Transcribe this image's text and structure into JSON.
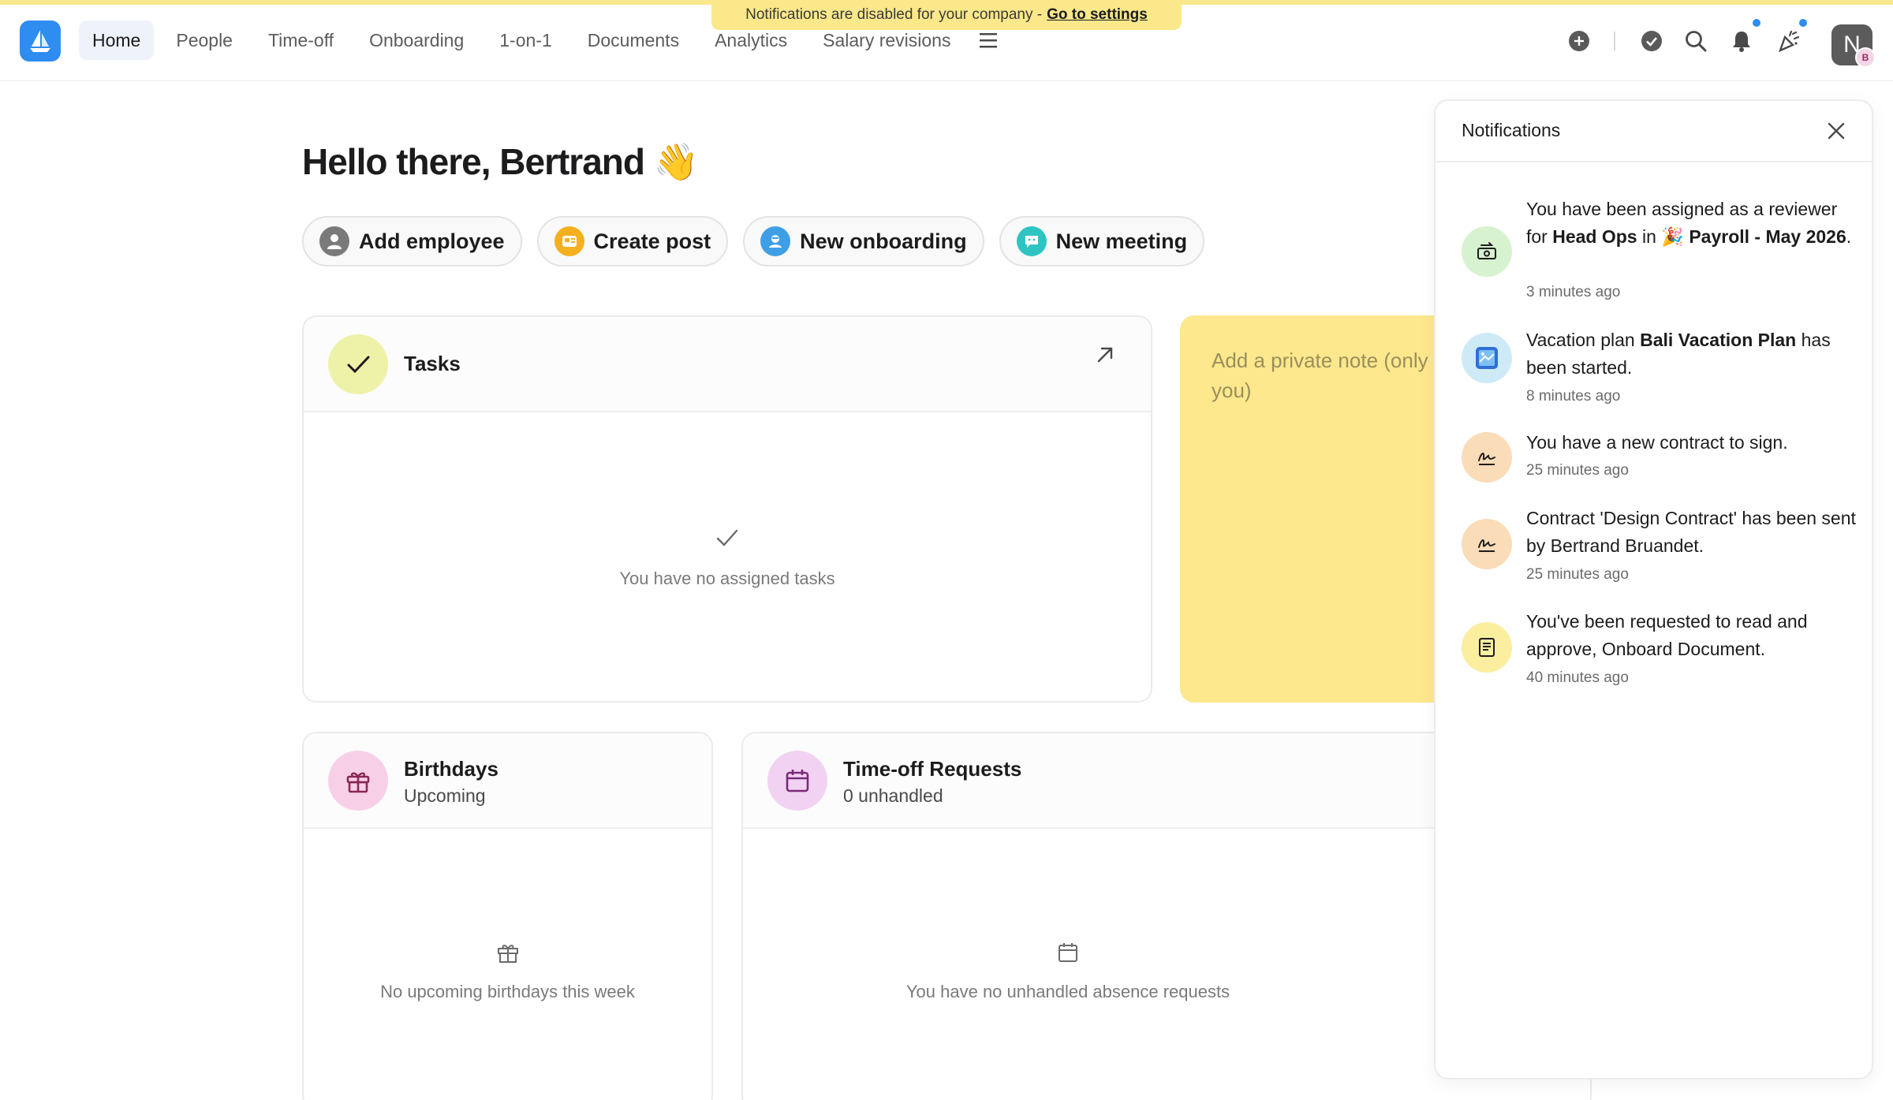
{
  "banner": {
    "text": "Notifications are disabled for your company -",
    "link": "Go to settings"
  },
  "nav": {
    "items": [
      {
        "label": "Home",
        "active": true
      },
      {
        "label": "People"
      },
      {
        "label": "Time-off"
      },
      {
        "label": "Onboarding"
      },
      {
        "label": "1-on-1"
      },
      {
        "label": "Documents"
      },
      {
        "label": "Analytics"
      },
      {
        "label": "Salary revisions"
      }
    ]
  },
  "header_icons": [
    "plus-circle-icon",
    "check-circle-icon",
    "search-icon",
    "bell-icon",
    "party-popper-icon"
  ],
  "user": {
    "avatar_initial": "N",
    "badge_initial": "B"
  },
  "greeting": "Hello there, Bertrand 👋",
  "actions": [
    {
      "label": "Add employee",
      "color": "#7a7a7a"
    },
    {
      "label": "Create post",
      "color": "#f5b01f"
    },
    {
      "label": "New onboarding",
      "color": "#3e9ee6"
    },
    {
      "label": "New meeting",
      "color": "#2ec4c4"
    }
  ],
  "tasks": {
    "title": "Tasks",
    "empty": "You have no assigned tasks"
  },
  "note": {
    "placeholder": "Add a private note (only you)"
  },
  "birthdays": {
    "title": "Birthdays",
    "subtitle": "Upcoming",
    "empty": "No upcoming birthdays this week"
  },
  "timeoff": {
    "title": "Time-off Requests",
    "subtitle": "0 unhandled",
    "empty": "You have no unhandled absence requests"
  },
  "notifications": {
    "title": "Notifications",
    "items": [
      {
        "parts": [
          "You have been assigned as a reviewer for ",
          "Head Ops",
          " in 🎉 ",
          "Payroll - May 2026",
          "."
        ],
        "time": "3 minutes ago",
        "icon": "money-transfer-icon",
        "color": "#d7f2cf"
      },
      {
        "parts": [
          "Vacation plan ",
          "Bali Vacation Plan",
          " has been started."
        ],
        "time": "8 minutes ago",
        "icon": "vacation-icon",
        "color": "#cfeaf7"
      },
      {
        "parts": [
          "You have a new contract to sign."
        ],
        "time": "25 minutes ago",
        "icon": "signature-icon",
        "color": "#fbdcb8"
      },
      {
        "parts": [
          "Contract 'Design Contract' has been sent by Bertrand Bruandet."
        ],
        "time": "25 minutes ago",
        "icon": "signature-icon",
        "color": "#fbdcb8"
      },
      {
        "parts": [
          "You've been requested to read and approve, Onboard Document."
        ],
        "time": "40 minutes ago",
        "icon": "document-icon",
        "color": "#fbee9e"
      }
    ]
  },
  "colors": {
    "accent": "#2f8cf0",
    "banner": "#fbe88a",
    "note": "#fde88e",
    "tasks_icon_bg": "#eef2a8",
    "birthday_icon_bg": "#f7d0e7",
    "timeoff_icon_bg": "#f2d2f2"
  }
}
